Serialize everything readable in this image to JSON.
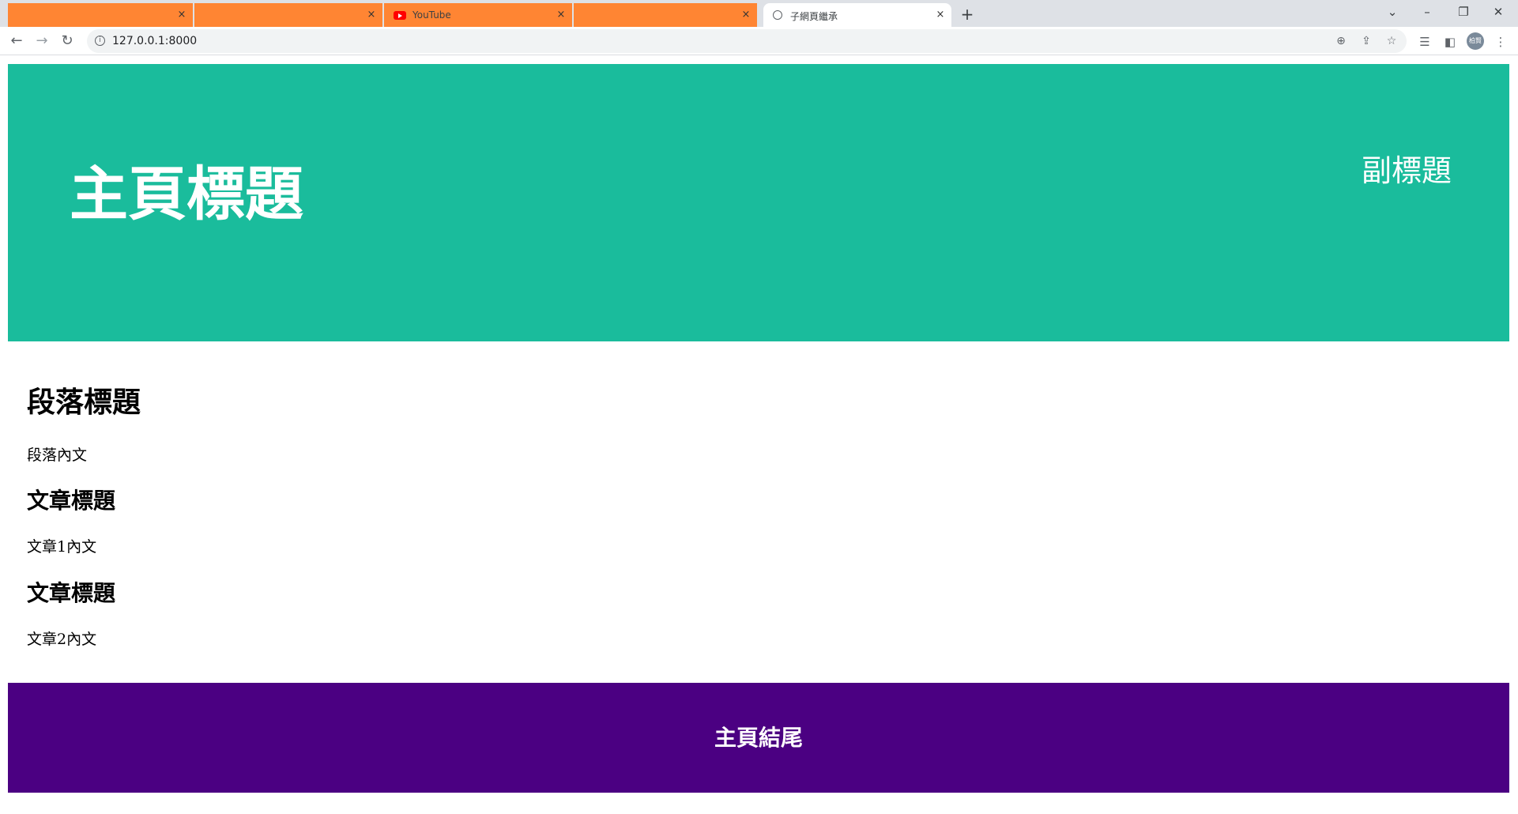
{
  "browser": {
    "tabs": [
      {
        "title": "",
        "redacted": true
      },
      {
        "title": "",
        "redacted": true
      },
      {
        "title": "YouTube",
        "redacted": true
      },
      {
        "title": "",
        "redacted": true
      },
      {
        "title": "子網頁繼承",
        "active": true
      }
    ],
    "close_glyph": "×",
    "new_tab_glyph": "+",
    "url": "127.0.0.1:8000",
    "avatar_text": "柏賢",
    "accent_redacted": "#ff8533"
  },
  "header": {
    "title": "主頁標題",
    "subtitle": "副標題",
    "background": "#1abc9c"
  },
  "main": {
    "section_title": "段落標題",
    "section_text": "段落內文",
    "articles": [
      {
        "title": "文章標題",
        "text": "文章1內文"
      },
      {
        "title": "文章標題",
        "text": "文章2內文"
      }
    ]
  },
  "footer": {
    "text": "主頁結尾",
    "background": "#4b0082"
  }
}
